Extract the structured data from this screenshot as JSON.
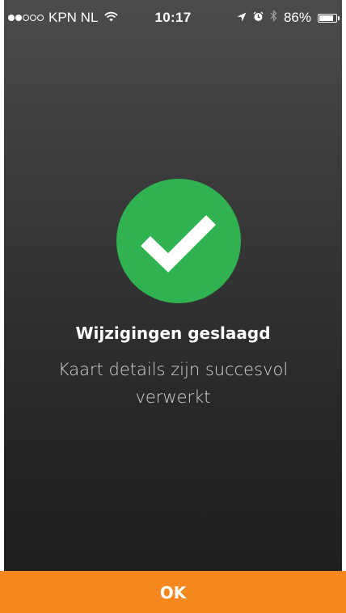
{
  "status_bar": {
    "carrier": "KPN NL",
    "time": "10:17",
    "battery": "86%",
    "signal_bars_filled": 2,
    "signal_bars_total": 5,
    "battery_level": 0.86
  },
  "success": {
    "icon": "checkmark-icon",
    "color": "#2fb24f",
    "title": "Wijzigingen geslaagd",
    "message": "Kaart details zijn succesvol verwerkt"
  },
  "actions": {
    "ok_label": "OK",
    "ok_color": "#f5871f"
  }
}
